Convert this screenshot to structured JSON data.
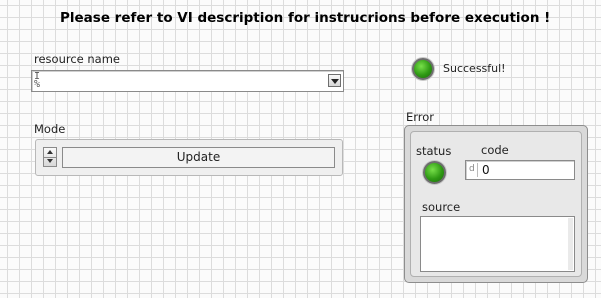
{
  "header": {
    "text": "Please refer to VI description for instrucrions before execution !"
  },
  "resource": {
    "label": "resource name",
    "value": "",
    "io_glyph_top": "I",
    "io_glyph_bottom": "/₀"
  },
  "mode": {
    "label": "Mode",
    "value": "Update"
  },
  "status_indicator": {
    "label": "Successful!",
    "state": "on",
    "color": "#2f9a14"
  },
  "error": {
    "label": "Error",
    "status_label": "status",
    "code_label": "code",
    "code_radix": "d",
    "code_value": "0",
    "source_label": "source",
    "source_value": ""
  }
}
